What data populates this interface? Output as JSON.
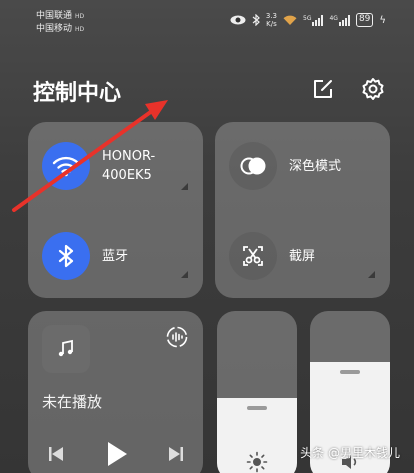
{
  "status_bar": {
    "carrier1": "中国联通",
    "carrier2": "中国移动",
    "carrier_tag": "HD",
    "net_speed_value": "3.3",
    "net_speed_unit": "K/s",
    "net_type1": "5G",
    "net_type2": "4G",
    "battery": "89"
  },
  "header": {
    "title": "控制中心",
    "edit_icon": "edit-icon",
    "settings_icon": "gear-icon"
  },
  "connectivity": {
    "wifi_label": "HONOR-400EK5",
    "wifi_line1": "HONOR-",
    "wifi_line2": "400EK5",
    "bluetooth_label": "蓝牙"
  },
  "tools": {
    "dark_mode_label": "深色模式",
    "screenshot_label": "截屏"
  },
  "media": {
    "status": "未在播放"
  },
  "sliders": {
    "brightness_level": 0.49,
    "volume_level": 0.7
  },
  "watermark": "头条 @男里木钱儿",
  "colors": {
    "accent": "#3a6ff0",
    "annotation_arrow": "#e8322a"
  }
}
